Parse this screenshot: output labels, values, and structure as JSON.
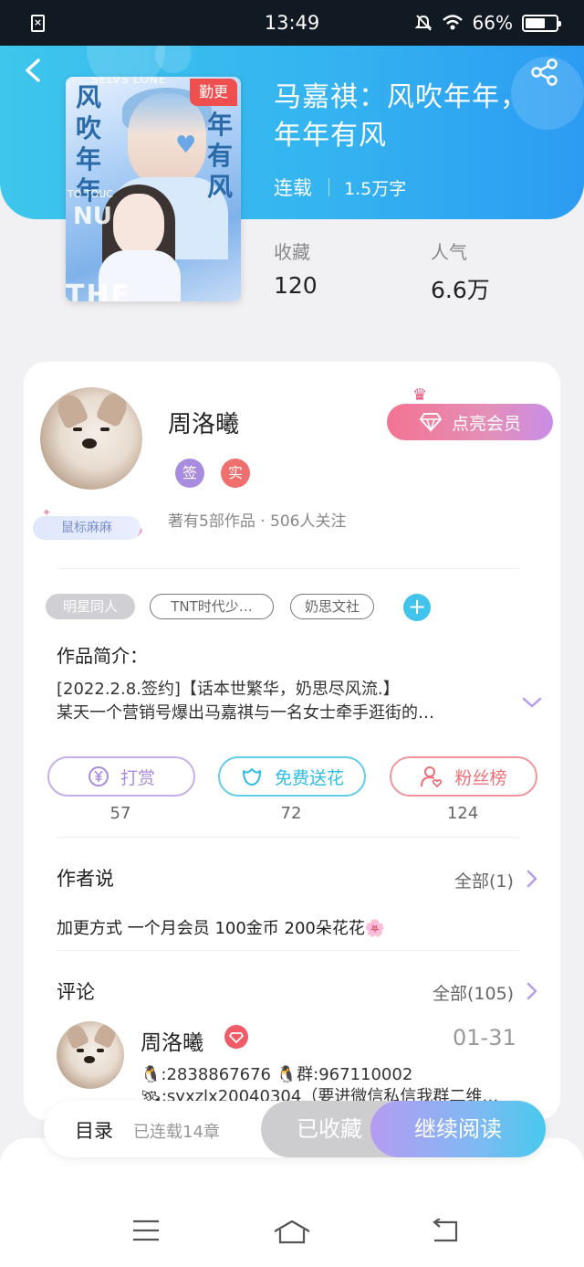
{
  "status_bar": {
    "time": "13:49",
    "battery": "66%",
    "battery_level": 0.66
  },
  "book": {
    "title": "马嘉祺：风吹年年，年年有风",
    "update_badge": "勤更",
    "status": "连载",
    "word_count": "1.5万字",
    "stats": [
      {
        "label": "收藏",
        "value": "120"
      },
      {
        "label": "人气",
        "value": "6.6万"
      }
    ],
    "cover": {
      "vertical_text_left": "风吹年年",
      "vertical_text_right": "年有风",
      "top_text": "SELVS LONE",
      "side_text": "TO TOUC",
      "big_text": "THE",
      "mid_text": "NU"
    }
  },
  "author": {
    "name": "周洛曦",
    "badges": [
      {
        "label": "签",
        "color": "#a98ce0"
      },
      {
        "label": "实",
        "color": "#ef6f6f"
      }
    ],
    "vip_button": "点亮会员",
    "meta": "著有5部作品 · 506人关注",
    "tag_label": "鼠标麻麻"
  },
  "tags": [
    {
      "label": "明星同人",
      "style": "filled"
    },
    {
      "label": "TNT时代少…",
      "style": "outline"
    },
    {
      "label": "奶思文社",
      "style": "outline"
    }
  ],
  "intro": {
    "heading": "作品简介：",
    "line1": "[2022.2.8.签约]【话本世繁华，奶思尽风流.】",
    "line2": "某天一个营销号爆出马嘉祺与一名女士牵手逛街的…"
  },
  "actions": [
    {
      "label": "打赏",
      "count": "57",
      "color": "#b48fe0"
    },
    {
      "label": "免费送花",
      "count": "72",
      "color": "#3fc4e8"
    },
    {
      "label": "粉丝榜",
      "count": "124",
      "color": "#ef6f78"
    }
  ],
  "author_says": {
    "heading": "作者说",
    "more": "全部(1)",
    "text": "加更方式 一个月会员 100金币 200朵花花🌸"
  },
  "comments": {
    "heading": "评论",
    "more": "全部(105)",
    "items": [
      {
        "name": "周洛曦",
        "date": "01-31",
        "line1": "🐧:2838867676 🐧群:967110002",
        "line2": "🛰:syxzlx20040304（要进微信私信我群二维…"
      }
    ]
  },
  "bottom": {
    "toc": "目录",
    "toc_sub": "已连载14章",
    "fav": "已收藏",
    "read": "继续阅读"
  }
}
